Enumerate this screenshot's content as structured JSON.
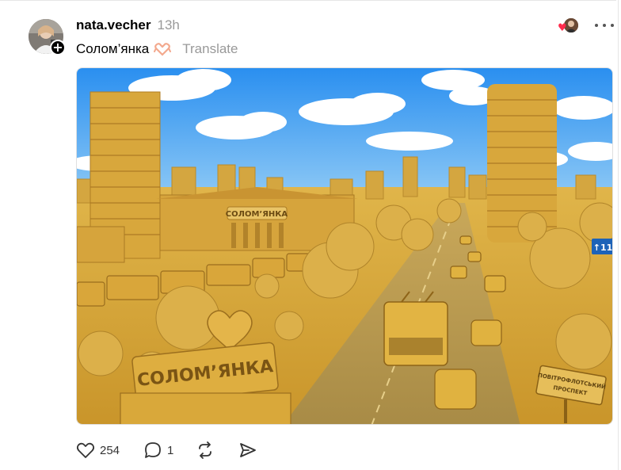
{
  "post": {
    "username": "nata.vecher",
    "timestamp": "13h",
    "caption": "Солом’янка",
    "caption_emoji": "heart-hands-icon",
    "translate_label": "Translate",
    "image": {
      "sign_text": "СОЛОМ’ЯНКА",
      "station_sign": "СОЛОМ’ЯНКА",
      "road_sign": "↑11",
      "street_sign_line1": "ПОВІТРОФЛОТСЬКИЙ",
      "street_sign_line2": "ПРОСПЕКТ"
    }
  },
  "actions": {
    "like_count": "254",
    "comment_count": "1"
  },
  "colors": {
    "text": "#000000",
    "muted": "#999999",
    "heart": "#ff2a4a"
  }
}
